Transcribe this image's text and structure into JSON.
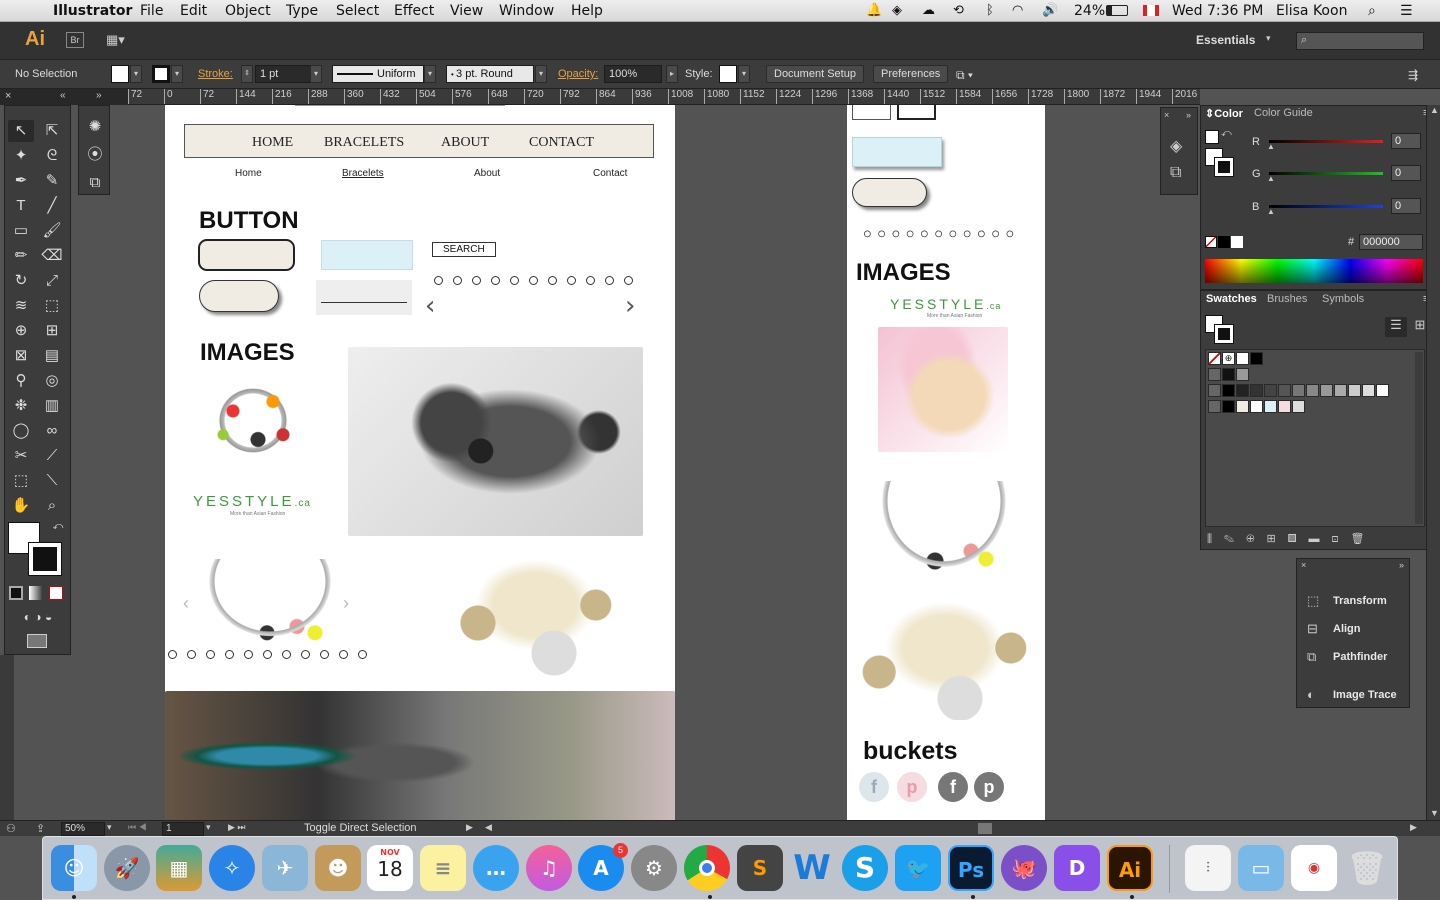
{
  "menubar": {
    "app_name": "Illustrator",
    "items": [
      "File",
      "Edit",
      "Object",
      "Type",
      "Select",
      "Effect",
      "View",
      "Window",
      "Help"
    ],
    "battery": "24%",
    "clock": "Wed 7:36 PM",
    "user": "Elisa Koon"
  },
  "appbar": {
    "logo": "Ai",
    "bridge": "Br",
    "workspace": "Essentials",
    "search_placeholder": ""
  },
  "control": {
    "selection": "No Selection",
    "stroke_label": "Stroke:",
    "stroke_weight": "1 pt",
    "stroke_profile": "Uniform",
    "brush": "3 pt. Round",
    "opacity_label": "Opacity:",
    "opacity": "100%",
    "style_label": "Style:",
    "document_setup": "Document Setup",
    "preferences": "Preferences"
  },
  "ruler_ticks": [
    "72",
    "0",
    "72",
    "144",
    "216",
    "288",
    "360",
    "432",
    "504",
    "576",
    "648",
    "720",
    "792",
    "864",
    "936",
    "1008",
    "1080",
    "1152",
    "1224",
    "1296",
    "1368",
    "1440",
    "1512",
    "1584",
    "1656",
    "1728",
    "1800",
    "1872",
    "1944",
    "2016"
  ],
  "artboard1": {
    "nav": [
      "HOME",
      "BRACELETS",
      "ABOUT",
      "CONTACT"
    ],
    "sublinks": [
      "Home",
      "Bracelets",
      "About",
      "Contact"
    ],
    "button_heading": "BUTTON",
    "search_label": "SEARCH",
    "images_heading": "IMAGES",
    "yesstyle": "YESSTYLE",
    "yesstyle_ca": ".ca",
    "yesstyle_tag": "More than Asian Fashion"
  },
  "artboard2": {
    "images_heading": "IMAGES",
    "yesstyle": "YESSTYLE",
    "yesstyle_ca": ".ca",
    "yesstyle_tag": "More than Asian Fashion",
    "buckets_heading": "buckets",
    "social": [
      "f",
      "p",
      "f",
      "p"
    ]
  },
  "color_panel": {
    "tabs": [
      "Color",
      "Color Guide"
    ],
    "channels": [
      {
        "label": "R",
        "value": "0",
        "color": "#e02020"
      },
      {
        "label": "G",
        "value": "0",
        "color": "#20c020"
      },
      {
        "label": "B",
        "value": "0",
        "color": "#2040e0"
      }
    ],
    "hex_label": "#",
    "hex": "000000"
  },
  "swatches_panel": {
    "tabs": [
      "Swatches",
      "Brushes",
      "Symbols"
    ]
  },
  "mini_panel": {
    "items": [
      "Transform",
      "Align",
      "Pathfinder",
      "Image Trace"
    ]
  },
  "statusbar": {
    "zoom": "50%",
    "artboard": "1",
    "status": "Toggle Direct Selection"
  },
  "dock": {
    "calendar_month": "NOV",
    "calendar_day": "18",
    "appstore_badge": "5",
    "icons": [
      "finder-icon",
      "launchpad-icon",
      "photos-icon",
      "safari-icon",
      "preview-icon",
      "contacts-icon",
      "calendar-icon",
      "notes-icon",
      "messages-icon",
      "itunes-icon",
      "appstore-icon",
      "system-preferences-icon",
      "chrome-icon",
      "sublime-icon",
      "word-icon",
      "skype-icon",
      "twitter-icon",
      "photoshop-icon",
      "github-icon",
      "dash-icon",
      "illustrator-icon",
      "archive-icon",
      "folder-icon",
      "document-icon",
      "trash-icon"
    ],
    "ps_label": "Ps",
    "ai_label": "Ai"
  }
}
